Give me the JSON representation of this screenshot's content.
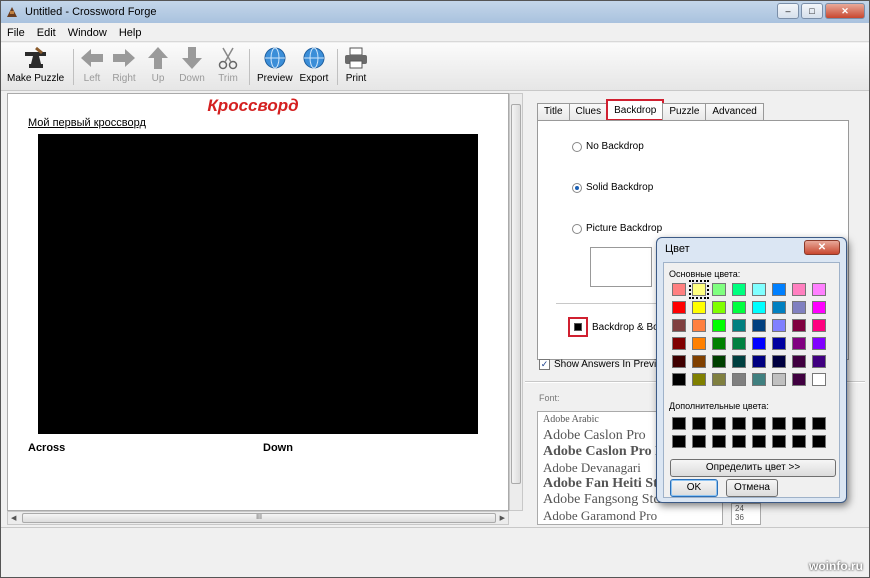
{
  "window": {
    "title": "Untitled - Crossword Forge",
    "min_icon": "minimize-icon",
    "max_icon": "maximize-icon",
    "close_glyph": "✕"
  },
  "menu": [
    "File",
    "Edit",
    "Window",
    "Help"
  ],
  "toolbar": {
    "items": [
      {
        "label": "Make Puzzle",
        "icon": "anvil-icon",
        "enabled": true
      },
      {
        "label": "Left",
        "icon": "arrow-left-icon",
        "enabled": false
      },
      {
        "label": "Right",
        "icon": "arrow-right-icon",
        "enabled": false
      },
      {
        "label": "Up",
        "icon": "arrow-up-icon",
        "enabled": false
      },
      {
        "label": "Down",
        "icon": "arrow-down-icon",
        "enabled": false
      },
      {
        "label": "Trim",
        "icon": "scissors-icon",
        "enabled": false
      },
      {
        "label": "Preview",
        "icon": "globe-icon",
        "enabled": true
      },
      {
        "label": "Export",
        "icon": "globe-icon",
        "enabled": true
      },
      {
        "label": "Print",
        "icon": "printer-icon",
        "enabled": true
      }
    ]
  },
  "editor": {
    "puzzle_title": "Кроссворд",
    "puzzle_subtitle": "Мой первый кроссворд",
    "across_label": "Across",
    "down_label": "Down",
    "scroll_grip": "III"
  },
  "tabs": [
    "Title",
    "Clues",
    "Backdrop",
    "Puzzle",
    "Advanced"
  ],
  "active_tab": "Backdrop",
  "backdrop": {
    "no_backdrop": "No Backdrop",
    "solid_backdrop": "Solid Backdrop",
    "picture_backdrop": "Picture Backdrop",
    "selected": "Solid Backdrop",
    "border_label": "Backdrop & Border",
    "swatch_color": "#000000"
  },
  "show_answers": {
    "label": "Show Answers In Preview",
    "checked": true
  },
  "font": {
    "label": "Font:",
    "families": [
      "Adobe Arabic",
      "Adobe Caslon Pro",
      "Adobe Caslon Pro Bold",
      "Adobe Devanagari",
      "Adobe Fan Heiti Std",
      "Adobe Fangsong Std",
      "Adobe Garamond Pro"
    ],
    "sizes": [
      "24",
      "36"
    ]
  },
  "color_dialog": {
    "title": "Цвет",
    "close_glyph": "✕",
    "basic_label": "Основные цвета:",
    "custom_label": "Дополнительные цвета:",
    "define_button": "Определить цвет >>",
    "ok_button": "OK",
    "cancel_button": "Отмена",
    "selected_basic_index": 1,
    "basic_colors": [
      "#ff8080",
      "#ffff80",
      "#80ff80",
      "#00ff80",
      "#80ffff",
      "#0080ff",
      "#ff80c0",
      "#ff80ff",
      "#ff0000",
      "#ffff00",
      "#80ff00",
      "#00ff40",
      "#00ffff",
      "#0080c0",
      "#8080c0",
      "#ff00ff",
      "#804040",
      "#ff8040",
      "#00ff00",
      "#008080",
      "#004080",
      "#8080ff",
      "#800040",
      "#ff0080",
      "#800000",
      "#ff8000",
      "#008000",
      "#008040",
      "#0000ff",
      "#0000a0",
      "#800080",
      "#8000ff",
      "#400000",
      "#804000",
      "#004000",
      "#004040",
      "#000080",
      "#000040",
      "#400040",
      "#400080",
      "#000000",
      "#808000",
      "#808040",
      "#808080",
      "#408080",
      "#c0c0c0",
      "#400040",
      "#ffffff"
    ],
    "custom_colors": [
      "#000000",
      "#000000",
      "#000000",
      "#000000",
      "#000000",
      "#000000",
      "#000000",
      "#000000",
      "#000000",
      "#000000",
      "#000000",
      "#000000",
      "#000000",
      "#000000",
      "#000000",
      "#000000"
    ]
  },
  "watermark": "woinfo.ru",
  "colors": {
    "accent_red": "#d02030",
    "title_red": "#d42020"
  }
}
